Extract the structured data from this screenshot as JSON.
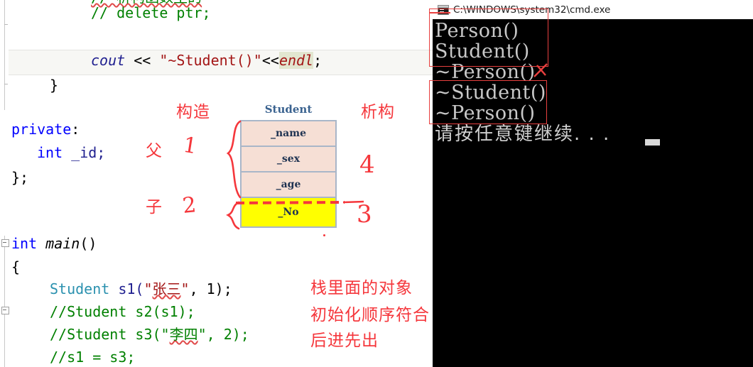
{
  "editor": {
    "lines": [
      {
        "id": "l0",
        "text": "// delete ptr;",
        "kind": "comment"
      },
      {
        "id": "l1",
        "text": "cout << \"~Student()\"<<endl;",
        "kind": "highlighted"
      },
      {
        "id": "l2",
        "text": "}",
        "kind": "plain"
      },
      {
        "id": "l3",
        "text": "private:",
        "kind": "keyword"
      },
      {
        "id": "l4",
        "text": "int _id;",
        "kind": "keyword"
      },
      {
        "id": "l5",
        "text": "};",
        "kind": "plain"
      },
      {
        "id": "l6",
        "text": "int main()",
        "kind": "keyword"
      },
      {
        "id": "l7",
        "text": "{",
        "kind": "plain"
      },
      {
        "id": "l8",
        "text": "Student s1(\"张三\", 1);",
        "kind": "code"
      },
      {
        "id": "l9",
        "text": "//Student s2(s1);",
        "kind": "comment"
      },
      {
        "id": "l10",
        "text": "//Student s3(\"李四\", 2);",
        "kind": "comment"
      },
      {
        "id": "l11",
        "text": "//s1 = s3;",
        "kind": "comment"
      }
    ],
    "tokens": {
      "comment_delete": "// delete ptr;",
      "cout": "cout",
      "shift1": " << ",
      "str_student_dtor": "\"~Student()\"",
      "shift2": "<<",
      "endl": "endl",
      "semicolon": ";",
      "close_brace": "}",
      "private": "private",
      "colon": ":",
      "int": "int",
      "id_var": "_id;",
      "class_end": "};",
      "int_main_kw": "int ",
      "main_name": "main",
      "main_parens": "()",
      "open_brace": "{",
      "student_type": "Student",
      "s1_var": " s1(",
      "zhangsan": "张三",
      "s1_args": ", 1);",
      "quote": "\"",
      "comment_s2": "//Student s2(s1);",
      "comment_s3_pre": "//Student s3(",
      "lisi": "李四",
      "comment_s3_post": ", 2);",
      "comment_s1_s3": "//s1 = s3;"
    }
  },
  "diagram": {
    "title": "Student",
    "rows": [
      {
        "label": "_name",
        "highlight": false
      },
      {
        "label": "_sex",
        "highlight": false
      },
      {
        "label": "_age",
        "highlight": false
      },
      {
        "label": "_No",
        "highlight": true
      }
    ]
  },
  "annotations": {
    "construct": "构造",
    "destruct": "析构",
    "parent": "父",
    "parent_num": "1",
    "child": "子",
    "child_num": "2",
    "right_num_top": "4",
    "right_num_bottom": "3",
    "note1": "栈里面的对象",
    "note2": "初始化顺序符合",
    "note3": "后进先出",
    "cross_mark": "✗"
  },
  "console": {
    "title": "C:\\WINDOWS\\system32\\cmd.exe",
    "icon": "console-window-icon",
    "output": [
      "Person()",
      "Student()",
      "~Person()",
      "~Student()",
      "~Person()"
    ],
    "prompt": "请按任意键继续. . ."
  },
  "colors": {
    "annotation_red": "#f5373c",
    "box_pink": "#f6dfd5",
    "box_highlight_yellow": "#ffff00",
    "box_border": "#a9b6c8",
    "console_bg": "#000000",
    "console_text": "#c8c8c8",
    "keyword_blue": "#0000ff",
    "comment_green": "#008000",
    "string_red": "#a31515",
    "type_teal": "#2b91af"
  }
}
